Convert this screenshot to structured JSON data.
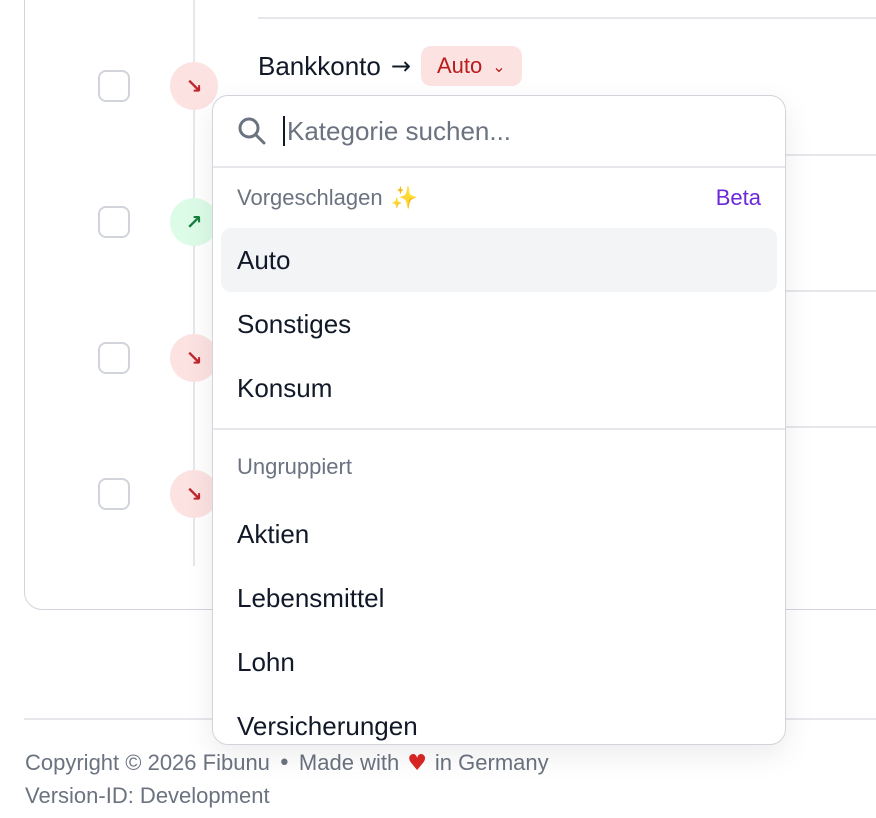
{
  "transactions": {
    "first_row": {
      "account": "Bankkonto",
      "category": "Auto"
    },
    "rows": [
      {
        "direction": "out"
      },
      {
        "direction": "in"
      },
      {
        "direction": "out"
      },
      {
        "direction": "out"
      }
    ]
  },
  "category_dropdown": {
    "search_placeholder": "Kategorie suchen...",
    "suggested": {
      "title": "Vorgeschlagen",
      "badge": "Beta",
      "items": [
        "Auto",
        "Sonstiges",
        "Konsum"
      ]
    },
    "ungrouped": {
      "title": "Ungruppiert",
      "items": [
        "Aktien",
        "Lebensmittel",
        "Lohn",
        "Versicherungen"
      ]
    }
  },
  "footer": {
    "copyright": "Copyright © 2026 Fibunu",
    "separator": "•",
    "made_with": "Made with",
    "made_in": "in Germany",
    "version": "Version-ID: Development"
  },
  "colors": {
    "expense": "#c0262d",
    "income": "#15803d",
    "beta": "#6d28d9",
    "sparkle": "#eab308"
  }
}
